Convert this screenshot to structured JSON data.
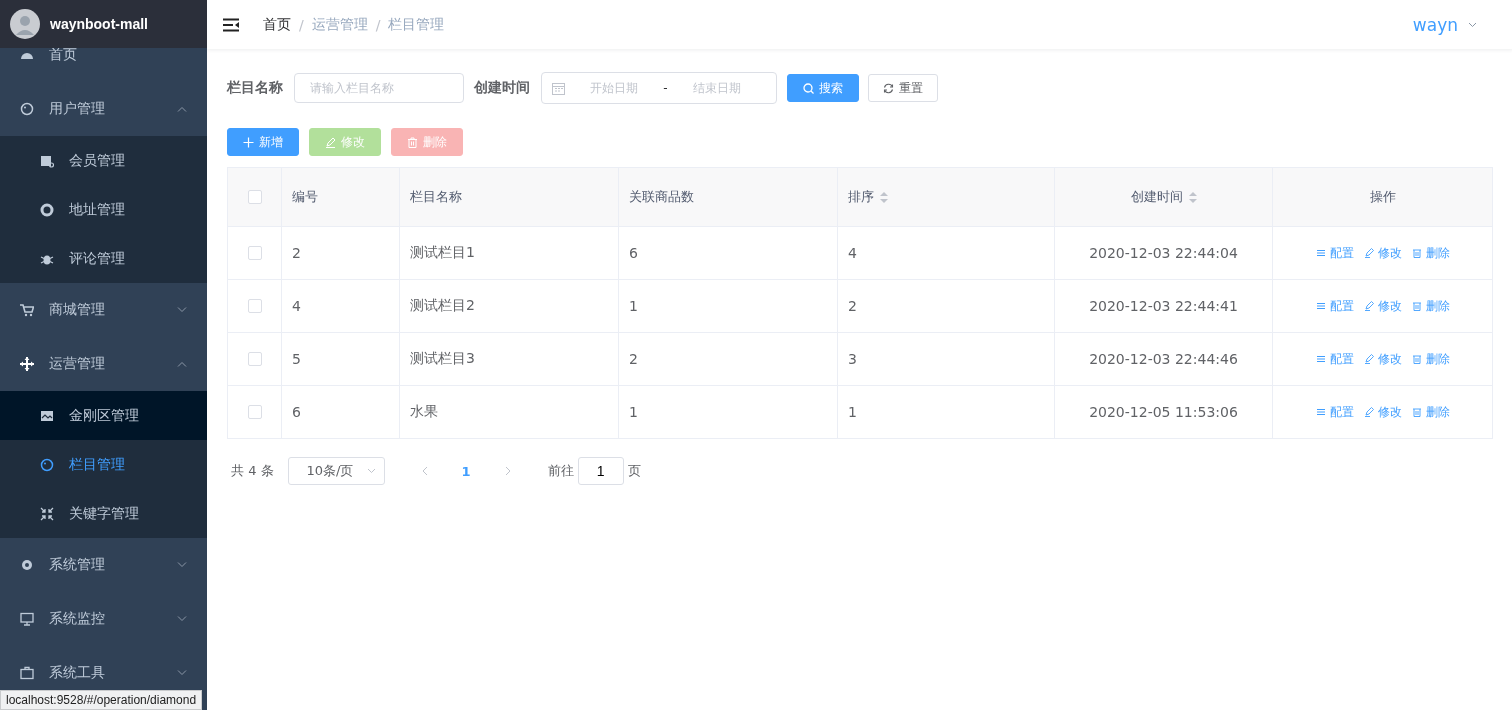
{
  "sidebar": {
    "title": "waynboot-mall",
    "items": [
      {
        "label": "首页"
      },
      {
        "label": "用户管理",
        "expanded": true,
        "children": [
          {
            "label": "会员管理",
            "selected": false,
            "hovered": false
          },
          {
            "label": "地址管理",
            "selected": false,
            "hovered": false
          },
          {
            "label": "评论管理",
            "selected": false,
            "hovered": false
          }
        ]
      },
      {
        "label": "商城管理",
        "expanded": false
      },
      {
        "label": "运营管理",
        "expanded": true,
        "children": [
          {
            "label": "金刚区管理",
            "selected": false,
            "hovered": true
          },
          {
            "label": "栏目管理",
            "selected": true,
            "hovered": false
          },
          {
            "label": "关键字管理",
            "selected": false,
            "hovered": false
          }
        ]
      },
      {
        "label": "系统管理",
        "expanded": false
      },
      {
        "label": "系统监控",
        "expanded": false
      },
      {
        "label": "系统工具",
        "expanded": false
      }
    ]
  },
  "breadcrumb": [
    {
      "label": "首页",
      "link": true
    },
    {
      "separator": "/",
      "label": "运营管理",
      "link": false
    },
    {
      "separator": "/",
      "label": "栏目管理",
      "link": false
    }
  ],
  "user": "wayn",
  "filters": {
    "name_label": "栏目名称",
    "name_placeholder": "请输入栏目名称",
    "date_label": "创建时间",
    "start_placeholder": "开始日期",
    "separator": "-",
    "end_placeholder": "结束日期",
    "search": "搜索",
    "reset": "重置"
  },
  "actions": [
    {
      "label": "新增",
      "kind": "add",
      "disabled": false
    },
    {
      "label": "修改",
      "kind": "edit",
      "disabled": true
    },
    {
      "label": "删除",
      "kind": "delete",
      "disabled": true
    }
  ],
  "table": {
    "all_checked": false,
    "columns": [
      {
        "label": "编号"
      },
      {
        "label": "栏目名称"
      },
      {
        "label": "关联商品数"
      },
      {
        "label": "排序",
        "sortable": true
      },
      {
        "label": "创建时间",
        "sortable": true
      },
      {
        "label": "操作"
      }
    ],
    "rows": [
      {
        "checked": false,
        "cells": [
          "2",
          "测试栏目1",
          "6",
          "4",
          "2020-12-03 22:44:04"
        ],
        "ops": [
          "配置",
          "修改",
          "删除"
        ]
      },
      {
        "checked": false,
        "cells": [
          "4",
          "测试栏目2",
          "1",
          "2",
          "2020-12-03 22:44:41"
        ],
        "ops": [
          "配置",
          "修改",
          "删除"
        ]
      },
      {
        "checked": false,
        "cells": [
          "5",
          "测试栏目3",
          "2",
          "3",
          "2020-12-03 22:44:46"
        ],
        "ops": [
          "配置",
          "修改",
          "删除"
        ]
      },
      {
        "checked": false,
        "cells": [
          "6",
          "水果",
          "1",
          "1",
          "2020-12-05 11:53:06"
        ],
        "ops": [
          "配置",
          "修改",
          "删除"
        ]
      }
    ]
  },
  "pagination": {
    "total": "共 4 条",
    "page_size": "10条/页",
    "pages": [
      {
        "label": "1",
        "selected": true
      }
    ],
    "goto_label": "前往",
    "goto_value": "1",
    "goto_suffix": "页"
  },
  "status_url": "localhost:9528/#/operation/diamond"
}
